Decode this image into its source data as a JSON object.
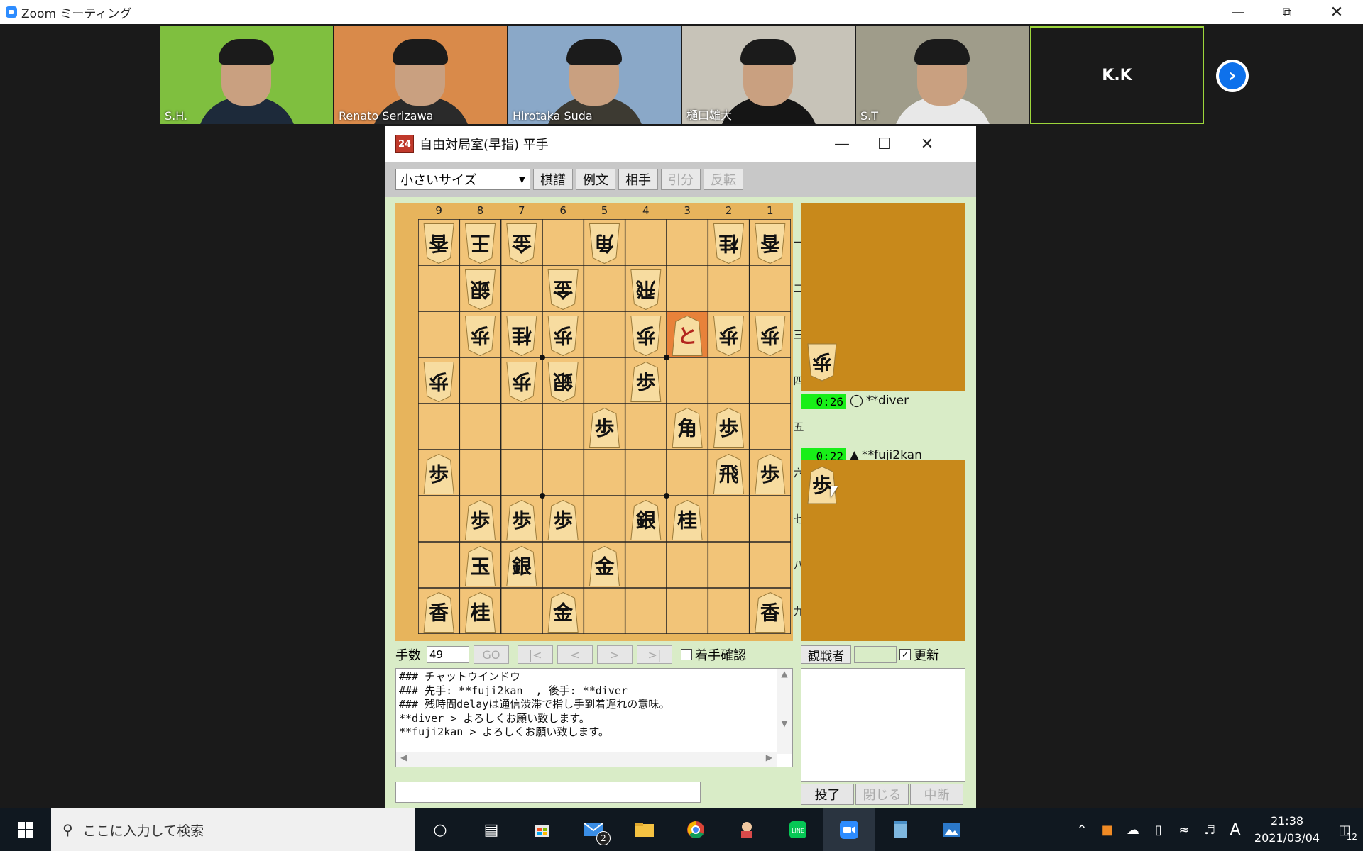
{
  "zoom": {
    "title": "Zoom ミーティング",
    "participants": [
      {
        "name": "S.H.",
        "bg": "#7fbf3f",
        "shirt": "#1d2a3a"
      },
      {
        "name": "Renato Serizawa",
        "bg": "#d98a4a",
        "shirt": "#2a2a2a"
      },
      {
        "name": "Hirotaka Suda",
        "bg": "#8aa8c8",
        "shirt": "#3d3a32"
      },
      {
        "name": "樋口雄大",
        "bg": "#c7c3b8",
        "shirt": "#151515"
      },
      {
        "name": "S.T",
        "bg": "#9f9c8a",
        "shirt": "#e8e8e8"
      }
    ],
    "kk_label": "K.K",
    "next_icon": "chevron-right-icon"
  },
  "app": {
    "icon_text": "24",
    "title": "自由対局室(早指) 平手",
    "toolbar": {
      "size_select": "小さいサイズ",
      "buttons": [
        "棋譜",
        "例文",
        "相手",
        "引分",
        "反転"
      ]
    },
    "col_numbers": [
      "9",
      "8",
      "7",
      "6",
      "5",
      "4",
      "3",
      "2",
      "1"
    ],
    "row_numbers": [
      "一",
      "二",
      "三",
      "四",
      "五",
      "六",
      "七",
      "八",
      "九"
    ],
    "board": [
      [
        "香v",
        "王v",
        "金v",
        "",
        "角v",
        "",
        "",
        "桂v",
        "香v"
      ],
      [
        "",
        "銀v",
        "",
        "金v",
        "",
        "飛v",
        "",
        "",
        ""
      ],
      [
        "",
        "歩v",
        "桂v",
        "歩v",
        "",
        "歩v",
        "と",
        "歩v",
        "歩v"
      ],
      [
        "歩v",
        "",
        "歩v",
        "銀v",
        "",
        "歩",
        "",
        "",
        ""
      ],
      [
        "",
        "",
        "",
        "",
        "歩",
        "",
        "角",
        "歩",
        ""
      ],
      [
        "歩",
        "",
        "",
        "",
        "",
        "",
        "",
        "飛",
        "歩"
      ],
      [
        "",
        "歩",
        "歩",
        "歩",
        "",
        "銀",
        "桂",
        "",
        ""
      ],
      [
        "",
        "玉",
        "銀",
        "",
        "金",
        "",
        "",
        "",
        ""
      ],
      [
        "香",
        "桂",
        "",
        "金",
        "",
        "",
        "",
        "",
        "香"
      ]
    ],
    "highlight_square": "3三",
    "gote_hand": [
      "歩"
    ],
    "sente_hand": [
      "歩"
    ],
    "gote_clock": "0:26",
    "gote_name": "**diver",
    "sente_clock": "0:22",
    "sente_name": "**fuji2kan",
    "move_label": "手数",
    "move_number": "49",
    "nav_buttons": [
      "GO",
      "|<",
      "<",
      ">",
      ">|"
    ],
    "confirm_label": "着手確認",
    "chat_lines": [
      "### チャットウインドウ",
      "### 先手: **fuji2kan  , 後手: **diver",
      "### 残時間delayは通信渋滞で指し手到着遅れの意味。",
      "**diver > よろしくお願い致します。",
      "**fuji2kan > よろしくお願い致します。"
    ],
    "watchers_label": "観戦者",
    "update_label": "更新",
    "bottom_buttons": [
      "投了",
      "閉じる",
      "中断"
    ]
  },
  "taskbar": {
    "search_placeholder": "ここに入力して検索",
    "mail_badge": "2",
    "ime": "A",
    "time": "21:38",
    "date": "2021/03/04",
    "notif_count": "12"
  }
}
